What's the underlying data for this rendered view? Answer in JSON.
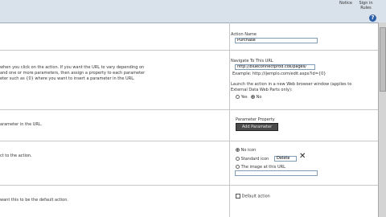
{
  "topbar": {
    "notif_right_a": "Notice",
    "notif_right_b_line1": "Sign in",
    "notif_right_b_line2": "Rules",
    "help_glyph": "?"
  },
  "section_action_name": {
    "label": "Action Name",
    "value": "Purchase"
  },
  "section_navigate": {
    "desc_line1": "when you click on the action. If you want the URL to vary depending on",
    "desc_line2": "and one or more parameters, then assign a property to each parameter",
    "desc_line3": "eter such as {0} where you want to insert a parameter in the URL.",
    "label": "Navigate To This URL",
    "url_value": "http://blueconnectprod.cds/pages/",
    "example": "Example: http://ijemplo.com/edit.aspx?id={0}",
    "launch_line1": "Launch the action in a new Web browser window (applies to",
    "launch_line2": "External Data Web Parts only):",
    "opt_yes": "Yes",
    "opt_no": "No"
  },
  "section_params": {
    "desc": "arameter in the URL.",
    "label": "Parameter Property",
    "button_label": "Add Parameter"
  },
  "section_icon": {
    "desc": "ct to the action.",
    "opt_no_icon": "No icon",
    "opt_standard_icon": "Standard icon",
    "standard_icon_value": "Delete",
    "opt_image_url": "The image at this URL"
  },
  "section_default": {
    "desc": "want this to be the default action.",
    "checkbox_label": "Default action"
  }
}
